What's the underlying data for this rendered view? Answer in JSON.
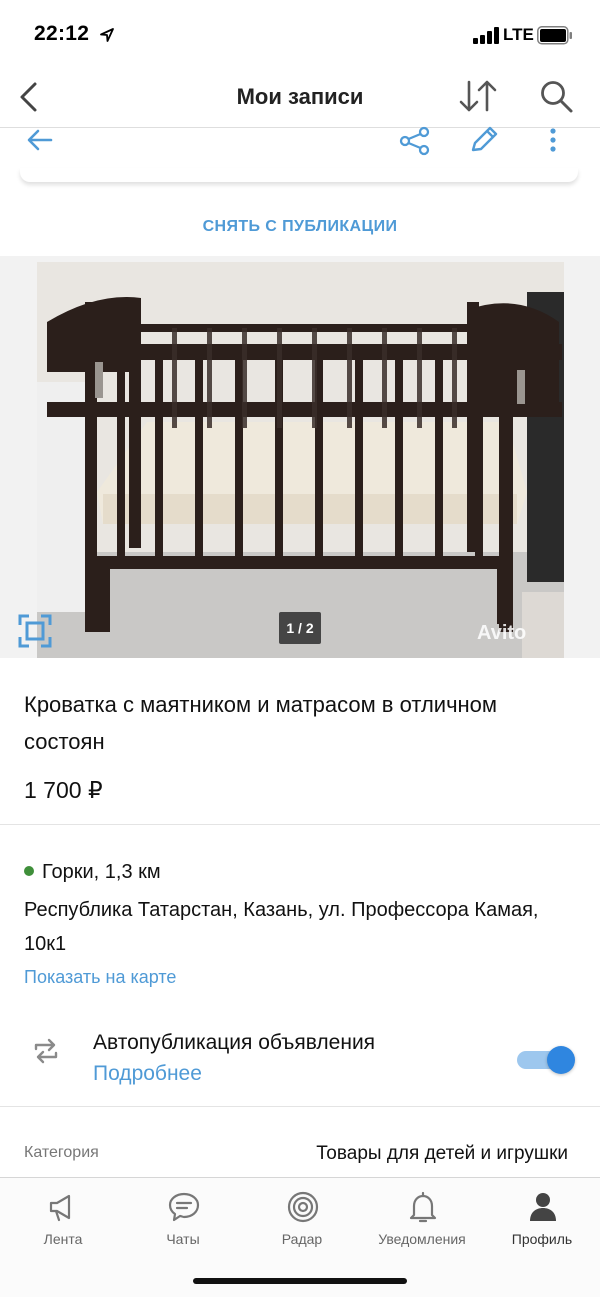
{
  "status_bar": {
    "time": "22:12",
    "network": "LTE"
  },
  "header": {
    "title": "Мои записи"
  },
  "actions": {
    "unpublish_label": "СНЯТЬ С ПУБЛИКАЦИИ"
  },
  "gallery": {
    "counter": "1 / 2",
    "watermark": "Avito"
  },
  "ad": {
    "title": "Кроватка с маятником и матрасом в отличном состоян",
    "price": "1 700 ₽"
  },
  "location": {
    "metro": "Горки, 1,3 км",
    "address": "Республика Татарстан, Казань, ул. Профессора Камая, 10к1",
    "map_link": "Показать на карте"
  },
  "autopublish": {
    "title": "Автопубликация объявления",
    "more_link": "Подробнее",
    "enabled": true
  },
  "details": {
    "category_label": "Категория",
    "category_value": "Товары для детей и игрушки"
  },
  "tabbar": {
    "items": [
      {
        "label": "Лента",
        "icon": "megaphone-icon"
      },
      {
        "label": "Чаты",
        "icon": "chat-icon"
      },
      {
        "label": "Радар",
        "icon": "radar-icon"
      },
      {
        "label": "Уведомления",
        "icon": "bell-icon"
      },
      {
        "label": "Профиль",
        "icon": "profile-icon"
      }
    ]
  },
  "colors": {
    "accent": "#4f9ad6",
    "toggle": "#2f86e0",
    "metro_dot": "#3f8f3a"
  }
}
